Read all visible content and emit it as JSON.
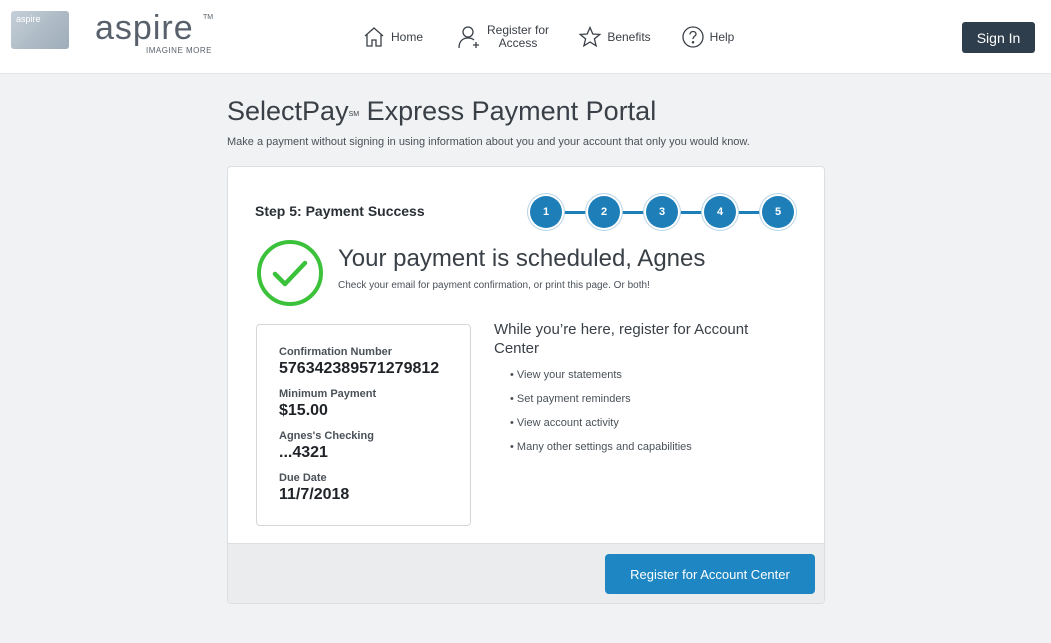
{
  "header": {
    "card_text": "aspire",
    "logo_word": "aspire",
    "logo_tm": "TM",
    "logo_tagline": "IMAGINE MORE",
    "nav": {
      "home": "Home",
      "register_line1": "Register for",
      "register_line2": "Access",
      "benefits": "Benefits",
      "help": "Help"
    },
    "sign_in": "Sign In"
  },
  "portal": {
    "title_main": "SelectPay",
    "title_sup": "SM",
    "title_rest": " Express Payment Portal",
    "subtitle": "Make a payment without signing in using information about you and your account that only you would know."
  },
  "step": {
    "label": "Step 5: Payment Success",
    "steps": [
      "1",
      "2",
      "3",
      "4",
      "5"
    ]
  },
  "result": {
    "title": "Your payment is scheduled, Agnes",
    "subtitle": "Check your email for payment confirmation, or print this page. Or both!"
  },
  "details": {
    "confirmation_label": "Confirmation Number",
    "confirmation_value": "576342389571279812",
    "min_payment_label": "Minimum Payment",
    "min_payment_value": "$15.00",
    "account_label": "Agnes's Checking",
    "account_value": "...4321",
    "due_label": "Due Date",
    "due_value": "11/7/2018"
  },
  "promo": {
    "title": "While you’re here, register for Account Center",
    "items": [
      "View your statements",
      "Set payment reminders",
      "View account activity",
      "Many other settings and capabilities"
    ],
    "button": "Register for Account Center"
  },
  "colors": {
    "accent": "#1e86c3",
    "step_blue": "#1e7fb8",
    "success_green": "#3cc13b",
    "sign_in_bg": "#2f3e4d"
  },
  "icons": [
    "home-icon",
    "register-user-icon",
    "star-icon",
    "help-icon",
    "check-circle-icon"
  ]
}
